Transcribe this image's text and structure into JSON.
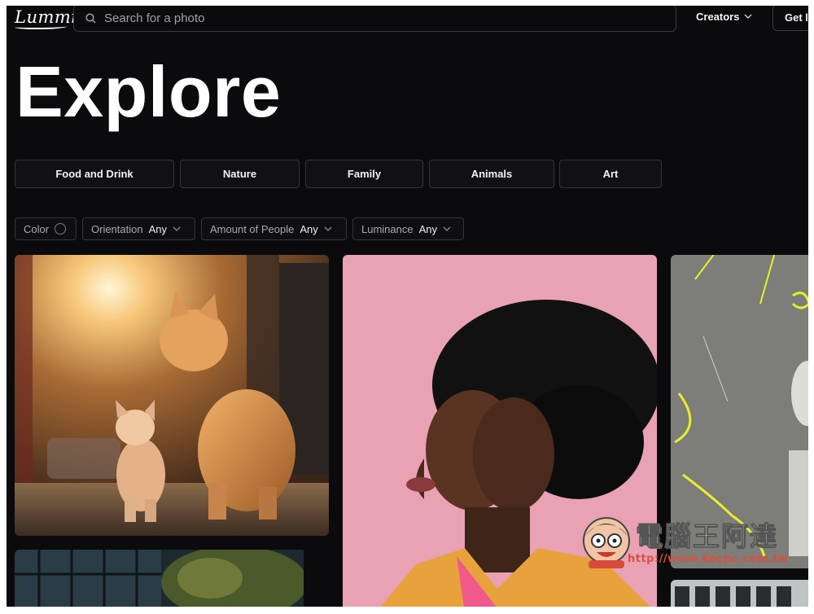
{
  "header": {
    "logo": "Lummi",
    "search_placeholder": "Search for a photo",
    "creators_label": "Creators",
    "get_label": "Get l"
  },
  "page_title": "Explore",
  "categories": [
    "Food and Drink",
    "Nature",
    "Family",
    "Animals",
    "Art"
  ],
  "filters": {
    "color_label": "Color",
    "orientation": {
      "label": "Orientation",
      "value": "Any"
    },
    "people": {
      "label": "Amount of People",
      "value": "Any"
    },
    "luminance": {
      "label": "Luminance",
      "value": "Any"
    }
  },
  "photos": [
    {
      "subject": "two cats at sunset"
    },
    {
      "subject": "woman with afro on pink background"
    },
    {
      "subject": "dancer with yellow light trails"
    },
    {
      "subject": "building and tree"
    },
    {
      "subject": "building windows"
    }
  ],
  "watermark": {
    "text": "電腦王阿達",
    "url": "http://www.kocpc.com.tw"
  },
  "icons": [
    "search-icon",
    "chevron-down-icon"
  ],
  "colors": {
    "background": "#0b0b0d",
    "border": "#34343a",
    "text": "#f2f2f2",
    "muted": "#a9a9b0"
  }
}
